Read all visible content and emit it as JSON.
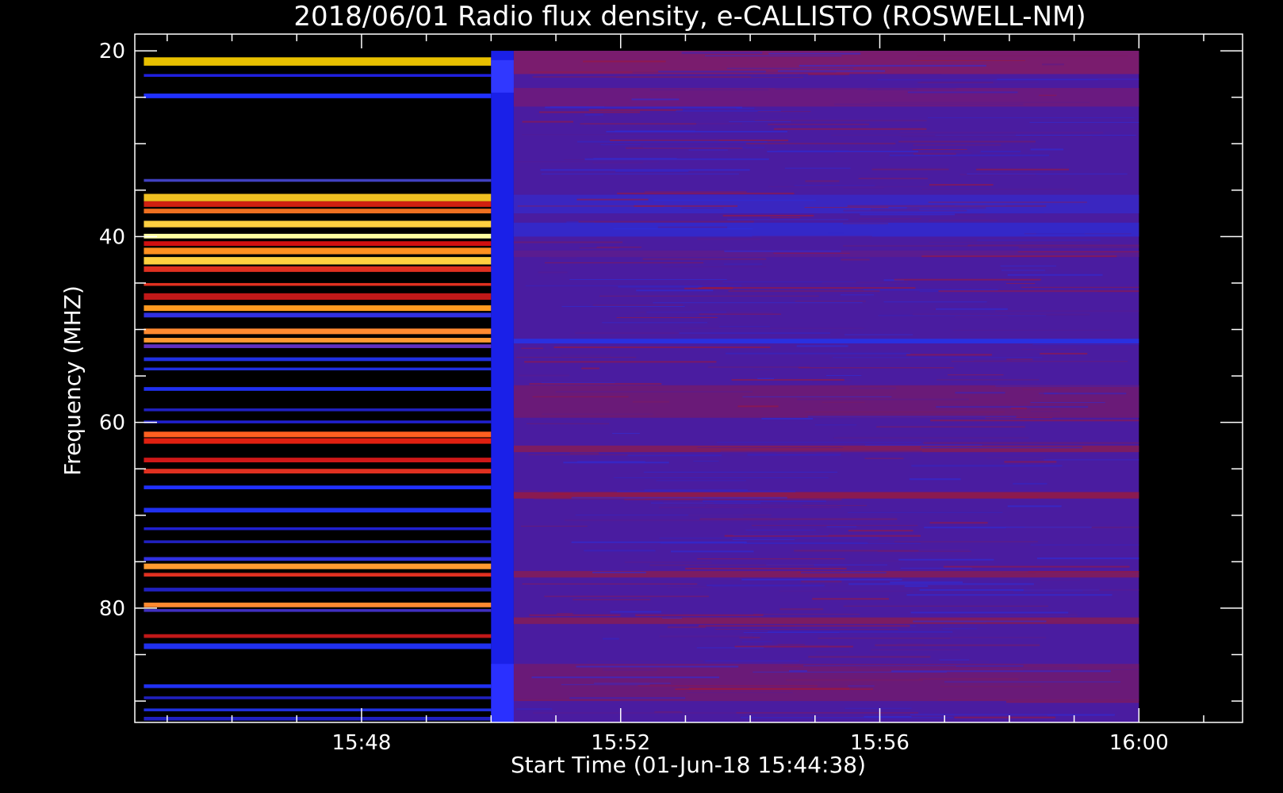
{
  "chart_data": {
    "type": "heatmap",
    "title": "2018/06/01  Radio flux density, e-CALLISTO (ROSWELL-NM)",
    "xlabel": "Start Time (01-Jun-18 15:44:38)",
    "ylabel": "Frequency (MHZ)",
    "x_ticks": [
      "15:48",
      "15:52",
      "15:56",
      "16:00"
    ],
    "x_tick_minutes": [
      228,
      232,
      236,
      240
    ],
    "y_ticks": [
      "20",
      "40",
      "60",
      "80"
    ],
    "y_tick_values": [
      20,
      40,
      60,
      80
    ],
    "xlim_minutes": [
      224.5,
      241.6
    ],
    "ylim": [
      92.3,
      18.2
    ],
    "data_time_range_minutes": [
      224.64,
      240.0
    ],
    "data_freq_range_mhz": [
      20,
      92.3
    ],
    "segments": [
      {
        "start_minute": 224.64,
        "end_minute": 230.0,
        "background": "#000000",
        "bands": [
          {
            "f1": 20.7,
            "f2": 21.6,
            "color": "#e8c000"
          },
          {
            "f1": 22.5,
            "f2": 22.8,
            "color": "#2020e0"
          },
          {
            "f1": 24.6,
            "f2": 25.1,
            "color": "#2030ff"
          },
          {
            "f1": 33.8,
            "f2": 34.1,
            "color": "#4040c0"
          },
          {
            "f1": 35.4,
            "f2": 36.2,
            "color": "#f0c020"
          },
          {
            "f1": 36.2,
            "f2": 36.8,
            "color": "#d02010"
          },
          {
            "f1": 37.0,
            "f2": 37.5,
            "color": "#f07020"
          },
          {
            "f1": 38.3,
            "f2": 39.0,
            "color": "#ffd040"
          },
          {
            "f1": 39.7,
            "f2": 40.2,
            "color": "#ffffa0"
          },
          {
            "f1": 40.5,
            "f2": 41.0,
            "color": "#d01010"
          },
          {
            "f1": 41.2,
            "f2": 41.9,
            "color": "#ff9020"
          },
          {
            "f1": 42.2,
            "f2": 43.0,
            "color": "#ffd040"
          },
          {
            "f1": 43.2,
            "f2": 43.8,
            "color": "#e03020"
          },
          {
            "f1": 45.0,
            "f2": 45.3,
            "color": "#e03020"
          },
          {
            "f1": 46.1,
            "f2": 46.8,
            "color": "#c01818"
          },
          {
            "f1": 47.4,
            "f2": 48.0,
            "color": "#ff9a20"
          },
          {
            "f1": 48.2,
            "f2": 48.7,
            "color": "#3030e0"
          },
          {
            "f1": 49.9,
            "f2": 50.5,
            "color": "#ff8a30"
          },
          {
            "f1": 50.9,
            "f2": 51.4,
            "color": "#ff9a30"
          },
          {
            "f1": 51.6,
            "f2": 52.0,
            "color": "#6030c0"
          },
          {
            "f1": 53.0,
            "f2": 53.4,
            "color": "#2030e0"
          },
          {
            "f1": 54.1,
            "f2": 54.4,
            "color": "#2030e0"
          },
          {
            "f1": 56.2,
            "f2": 56.6,
            "color": "#2030f0"
          },
          {
            "f1": 58.5,
            "f2": 58.8,
            "color": "#2020c0"
          },
          {
            "f1": 59.8,
            "f2": 60.1,
            "color": "#2020d0"
          },
          {
            "f1": 61.0,
            "f2": 61.6,
            "color": "#ff6020"
          },
          {
            "f1": 61.7,
            "f2": 62.3,
            "color": "#e02010"
          },
          {
            "f1": 63.8,
            "f2": 64.3,
            "color": "#d01818"
          },
          {
            "f1": 65.0,
            "f2": 65.5,
            "color": "#e03020"
          },
          {
            "f1": 66.8,
            "f2": 67.2,
            "color": "#2030ff"
          },
          {
            "f1": 69.2,
            "f2": 69.7,
            "color": "#2030f0"
          },
          {
            "f1": 71.3,
            "f2": 71.6,
            "color": "#2020d0"
          },
          {
            "f1": 72.7,
            "f2": 73.0,
            "color": "#2020c0"
          },
          {
            "f1": 74.5,
            "f2": 74.9,
            "color": "#3030e0"
          },
          {
            "f1": 75.2,
            "f2": 75.8,
            "color": "#ff9a30"
          },
          {
            "f1": 76.2,
            "f2": 76.6,
            "color": "#e03020"
          },
          {
            "f1": 77.8,
            "f2": 78.2,
            "color": "#2020c0"
          },
          {
            "f1": 79.4,
            "f2": 79.9,
            "color": "#ff8a30"
          },
          {
            "f1": 80.1,
            "f2": 80.4,
            "color": "#4030c0"
          },
          {
            "f1": 82.8,
            "f2": 83.2,
            "color": "#c01818"
          },
          {
            "f1": 83.8,
            "f2": 84.4,
            "color": "#2030f0"
          },
          {
            "f1": 88.2,
            "f2": 88.6,
            "color": "#2030f0"
          },
          {
            "f1": 89.5,
            "f2": 89.8,
            "color": "#2020c0"
          },
          {
            "f1": 90.8,
            "f2": 91.1,
            "color": "#2030e0"
          },
          {
            "f1": 91.7,
            "f2": 92.1,
            "color": "#2020c0"
          }
        ]
      },
      {
        "start_minute": 230.0,
        "end_minute": 230.35,
        "background": "#1a20e8",
        "bands": [
          {
            "f1": 21.0,
            "f2": 24.5,
            "color": "#3038ff"
          },
          {
            "f1": 86.0,
            "f2": 92.3,
            "color": "#2a30ff"
          }
        ]
      },
      {
        "start_minute": 230.35,
        "end_minute": 240.0,
        "background": "#4a1ca0",
        "bands": [
          {
            "f1": 20.0,
            "f2": 22.5,
            "color": "#7a1c6e"
          },
          {
            "f1": 24.0,
            "f2": 26.0,
            "color": "#6a1a80"
          },
          {
            "f1": 35.5,
            "f2": 37.5,
            "color": "#3a26c0"
          },
          {
            "f1": 38.5,
            "f2": 40.0,
            "color": "#3428c8"
          },
          {
            "f1": 41.5,
            "f2": 42.2,
            "color": "#5a1c90"
          },
          {
            "f1": 51.0,
            "f2": 51.5,
            "color": "#2a30e0"
          },
          {
            "f1": 56.0,
            "f2": 59.5,
            "color": "#6a1a78"
          },
          {
            "f1": 62.5,
            "f2": 63.2,
            "color": "#7c1c62"
          },
          {
            "f1": 67.5,
            "f2": 68.2,
            "color": "#8a1a50"
          },
          {
            "f1": 76.0,
            "f2": 76.7,
            "color": "#7c1c62"
          },
          {
            "f1": 81.0,
            "f2": 81.7,
            "color": "#7c1c62"
          },
          {
            "f1": 86.0,
            "f2": 90.0,
            "color": "#6a1a78"
          }
        ]
      }
    ],
    "colormap": [
      "#000000",
      "#1a20e8",
      "#4a1ca0",
      "#c01818",
      "#ff9a20",
      "#ffff80"
    ],
    "grid": false
  }
}
